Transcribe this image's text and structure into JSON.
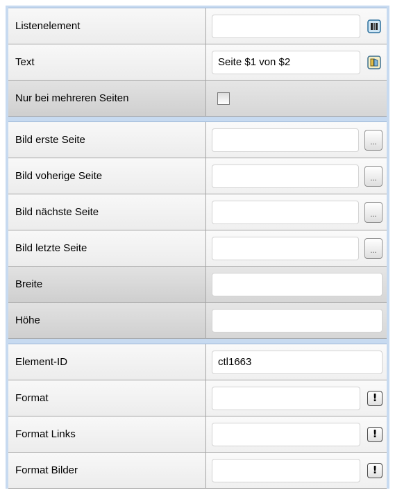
{
  "group1": {
    "list_element": {
      "label": "Listenelement",
      "value": ""
    },
    "text": {
      "label": "Text",
      "value": "Seite $1 von $2"
    },
    "multi_pages_only": {
      "label": "Nur bei mehreren Seiten",
      "checked": false
    }
  },
  "group2": {
    "first_page_image": {
      "label": "Bild erste Seite",
      "value": "",
      "button": "..."
    },
    "previous_page_image": {
      "label": "Bild voherige Seite",
      "value": "",
      "button": "..."
    },
    "next_page_image": {
      "label": "Bild nächste Seite",
      "value": "",
      "button": "..."
    },
    "last_page_image": {
      "label": "Bild letzte Seite",
      "value": "",
      "button": "..."
    },
    "width": {
      "label": "Breite",
      "value": ""
    },
    "height": {
      "label": "Höhe",
      "value": ""
    }
  },
  "group3": {
    "element_id": {
      "label": "Element-ID",
      "value": "ctl1663"
    },
    "format": {
      "label": "Format",
      "value": "",
      "button": "!"
    },
    "format_links": {
      "label": "Format Links",
      "value": "",
      "button": "!"
    },
    "format_images": {
      "label": "Format Bilder",
      "value": "",
      "button": "!"
    }
  }
}
